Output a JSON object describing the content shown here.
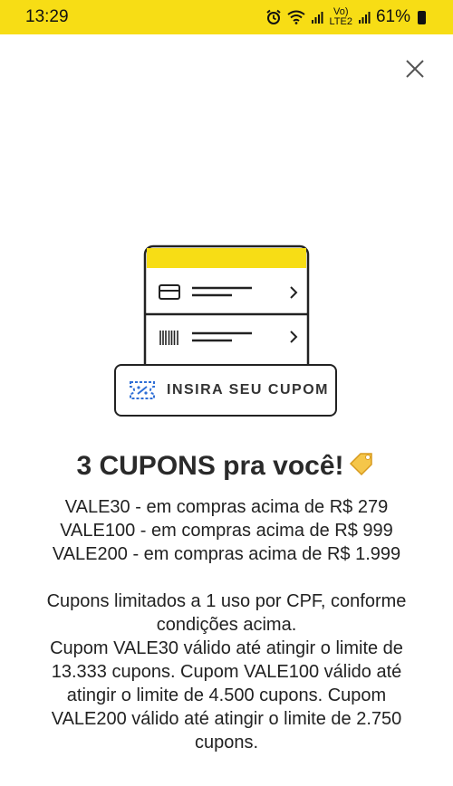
{
  "status_bar": {
    "time": "13:29",
    "network_top": "Vo)",
    "network_bottom": "LTE2",
    "battery": "61%",
    "icons": [
      "alarm-icon",
      "wifi-icon",
      "signal-icon",
      "battery-icon"
    ]
  },
  "illustration": {
    "accent_color": "#f7dd15",
    "icons": [
      "credit-card-icon",
      "barcode-icon",
      "coupon-ticket-icon",
      "chevron-right-icon"
    ]
  },
  "coupon_button": {
    "label": "INSIRA SEU CUPOM"
  },
  "title": {
    "text": "3 CUPONS pra você!",
    "emoji": "label-tag-icon"
  },
  "coupons": [
    "VALE30 - em compras acima de R$ 279",
    "VALE100 - em compras acima de R$ 999",
    "VALE200 - em compras acima de R$ 1.999"
  ],
  "terms": {
    "line1": "Cupons limitados a 1 uso por CPF, conforme condições acima.",
    "line2": "Cupom VALE30 válido até atingir o limite de 13.333 cupons. Cupom VALE100 válido até atingir o limite de 4.500 cupons. Cupom VALE200 válido até atingir o limite de 2.750 cupons."
  },
  "colors": {
    "brand_yellow": "#f7dd15",
    "text": "#222222",
    "accent_blue": "#2f6fd6"
  }
}
